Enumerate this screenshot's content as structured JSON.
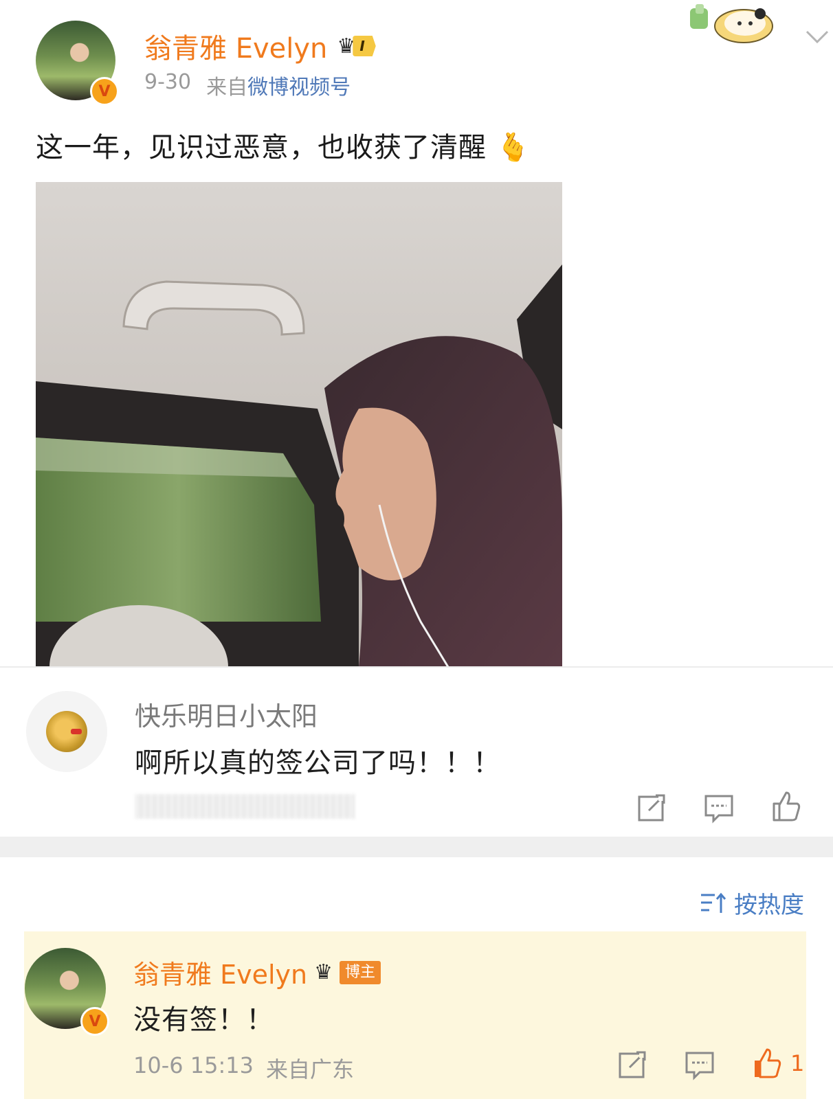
{
  "post": {
    "user_name": "翁青雅 Evelyn",
    "level": "I",
    "date": "9-30",
    "source_prefix": "来自",
    "source": "微博视频号",
    "text": "这一年，见识过恶意，也收获了清醒",
    "text_emoji": "🫰"
  },
  "comment": {
    "user_name": "快乐明日小太阳",
    "text": "啊所以真的签公司了吗！！！"
  },
  "sort": {
    "label": "按热度"
  },
  "reply": {
    "user_name": "翁青雅 Evelyn",
    "badge": "博主",
    "text": "没有签！！",
    "time": "10-6 15:13",
    "location": "来自广东",
    "likes": "1"
  },
  "colors": {
    "username": "#f07a1d",
    "source_link": "#5079b8",
    "reply_bg": "#fdf7dd",
    "liked": "#ee6a1e"
  },
  "icons": [
    "chevron-down-icon",
    "share-icon",
    "comment-icon",
    "like-icon",
    "sort-icon",
    "verified-badge-icon",
    "crown-icon"
  ]
}
